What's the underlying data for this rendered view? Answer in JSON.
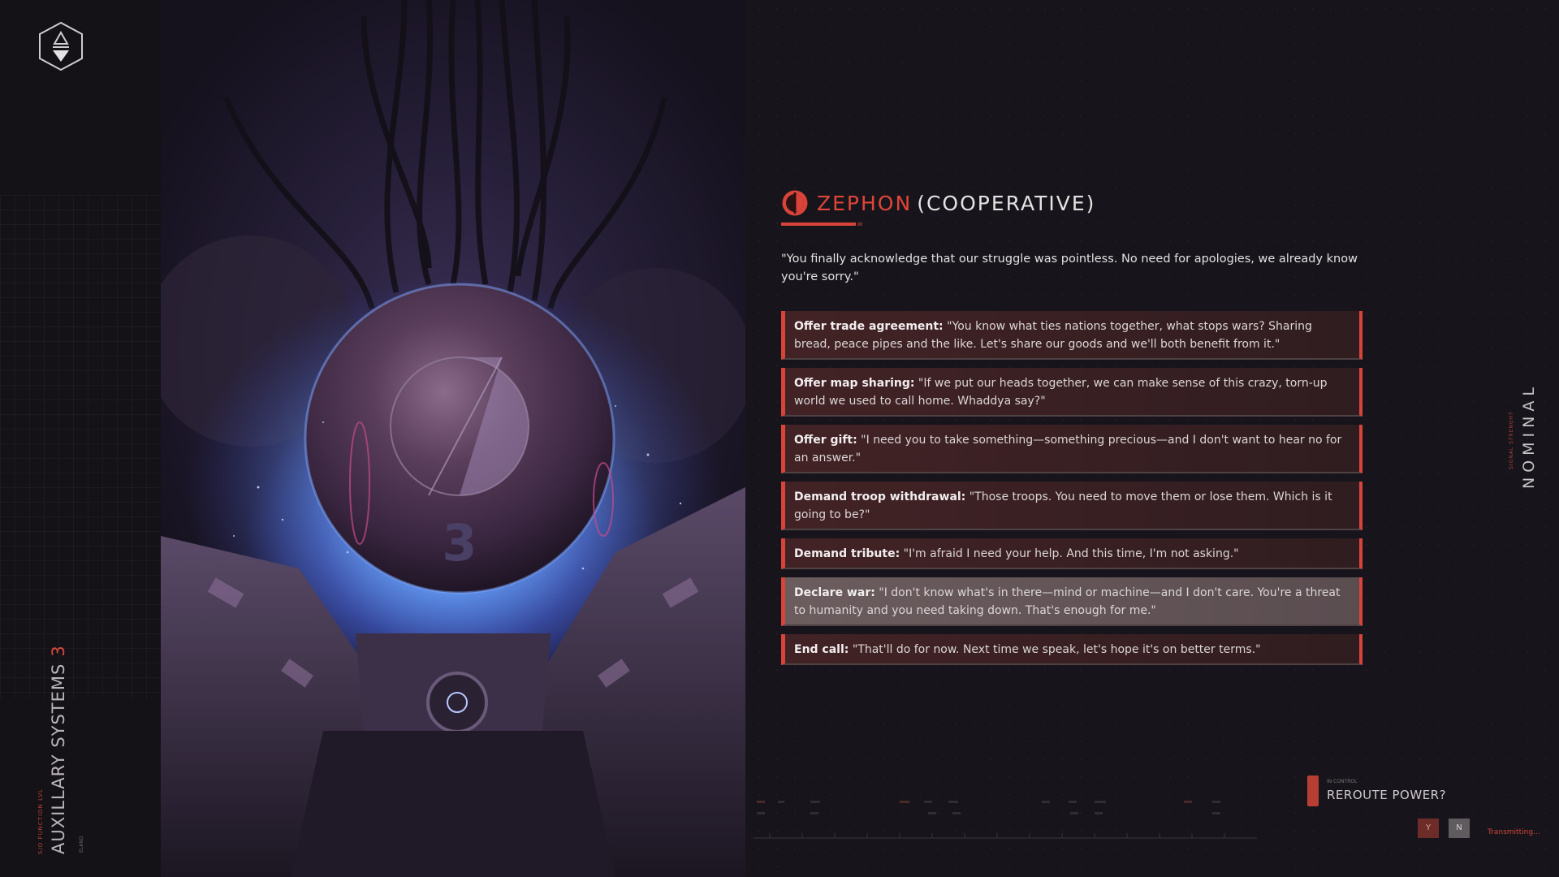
{
  "sidebar": {
    "title": "AUXILLARY SYSTEMS",
    "title_number": "3",
    "subtitle": "S/O FUNCTION LVL",
    "small_label": "ELAND",
    "logo_icon": "hexagon-emblem-icon"
  },
  "artwork": {
    "sphere_number": "3",
    "description_icon": "alien-sphere-artwork"
  },
  "dialog": {
    "faction_name": "ZEPHON",
    "faction_state": "(COOPERATIVE)",
    "faction_icon": "zephon-faction-icon",
    "faction_color": "#e0453a",
    "quote": "\"You finally acknowledge that our struggle was pointless. No need for apologies, we already know you're sorry.\"",
    "options": [
      {
        "label": "Offer trade agreement:",
        "text": " \"You know what ties nations together, what stops wars? Sharing bread, peace pipes and the like. Let's share our goods and we'll both benefit from it.\""
      },
      {
        "label": "Offer map sharing:",
        "text": " \"If we put our heads together, we can make sense of this crazy, torn-up world we used to call home. Whaddya say?\""
      },
      {
        "label": "Offer gift:",
        "text": " \"I need you to take something—something precious—and I don't want to hear no for an answer.\""
      },
      {
        "label": "Demand troop withdrawal:",
        "text": " \"Those troops. You need to move them or lose them. Which is it going to be?\""
      },
      {
        "label": "Demand tribute:",
        "text": " \"I'm afraid I need your help. And this time, I'm not asking.\""
      },
      {
        "label": "Declare war:",
        "text": " \"I don't know what's in there—mind or machine—and I don't care. You're a threat to humanity and you need taking down. That's enough for me.\""
      },
      {
        "label": "End call:",
        "text": " \"That'll do for now. Next time we speak, let's hope it's on better terms.\""
      }
    ]
  },
  "status": {
    "nominal": "NOMINAL",
    "signal_label": "SIGNAL STRENGHT"
  },
  "reroute": {
    "small_label": "IN CONTROL",
    "question": "REROUTE POWER?",
    "yes": "Y",
    "no": "N",
    "transmitting": "Transmitting..."
  }
}
